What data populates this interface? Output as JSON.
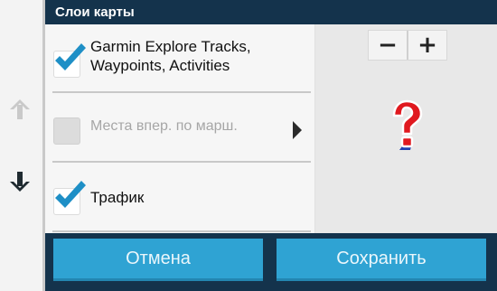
{
  "dialog": {
    "title": "Слои карты"
  },
  "layers": [
    {
      "label": "Garmin Explore Tracks, Waypoints, Activities",
      "checked": true,
      "enabled": true
    },
    {
      "label": "Места впер. по марш.",
      "checked": false,
      "enabled": false,
      "has_submenu": true
    },
    {
      "label": "Трафик",
      "checked": true,
      "enabled": true
    }
  ],
  "map_preview": {
    "zoom_out_label": "−",
    "zoom_in_label": "+",
    "marker_icon": "question-mark-icon"
  },
  "footer": {
    "cancel_label": "Отмена",
    "save_label": "Сохранить"
  },
  "left_rail": {
    "up_icon": "arrow-up-icon",
    "down_icon": "arrow-down-icon"
  },
  "colors": {
    "title_bar": "#14334c",
    "button": "#2fa3d3",
    "checkmark": "#1e8fc6",
    "question_mark": "#e0191f"
  }
}
